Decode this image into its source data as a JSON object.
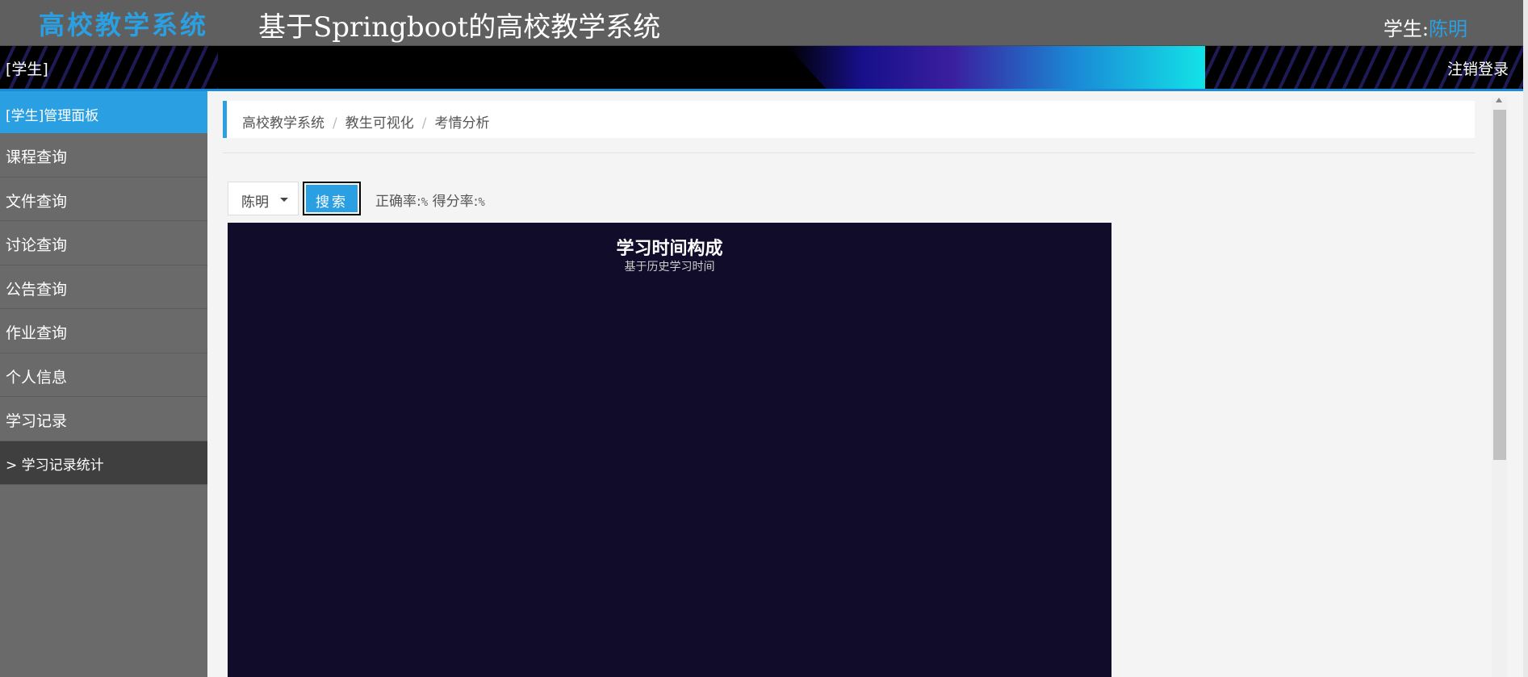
{
  "header": {
    "brand": "高校教学系统",
    "title": "基于Springboot的高校教学系统",
    "user_prefix": "学生:",
    "user_name": "陈明"
  },
  "banner": {
    "role": "[学生]",
    "logout": "注销登录"
  },
  "sidebar": {
    "header": "[学生]管理面板",
    "items": [
      {
        "label": "课程查询"
      },
      {
        "label": "文件查询"
      },
      {
        "label": "讨论查询"
      },
      {
        "label": "公告查询"
      },
      {
        "label": "作业查询"
      },
      {
        "label": "个人信息"
      },
      {
        "label": "学习记录"
      },
      {
        "label": ">  学习记录统计",
        "active": true
      }
    ]
  },
  "breadcrumb": [
    "高校教学系统",
    "教生可视化",
    "考情分析"
  ],
  "filter": {
    "student_selected": "陈明",
    "search_label": "搜索",
    "accuracy_label": "正确率:",
    "accuracy_value": "%",
    "score_label": "得分率:",
    "score_value": "%"
  },
  "chart_data": {
    "type": "pie",
    "title": "学习时间构成",
    "subtitle": "基于历史学习时间",
    "background": "#100c2a",
    "series": []
  },
  "colors": {
    "accent": "#2aa0e3",
    "topbar": "#5f5f5f",
    "sidebar": "#6a6a6a",
    "chart_bg": "#100c2a"
  }
}
